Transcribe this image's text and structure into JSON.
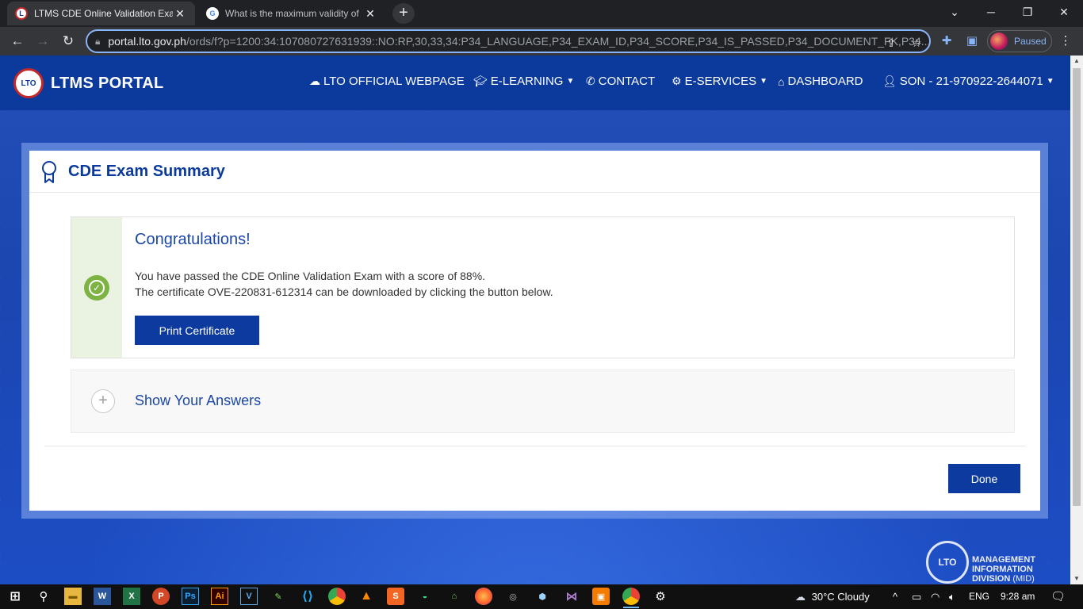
{
  "browser": {
    "tabs": [
      {
        "title": "LTMS CDE Online Validation Exam",
        "active": true
      },
      {
        "title": "What is the maximum validity of",
        "active": false
      }
    ],
    "url_host": "portal.lto.gov.ph",
    "url_path": "/ords/f?p=1200:34:107080727631939::NO:RP,30,33,34:P34_LANGUAGE,P34_EXAM_ID,P34_SCORE,P34_IS_PASSED,P34_DOCUMENT_FK,P34...",
    "profile_status": "Paused"
  },
  "nav": {
    "brand": "LTMS PORTAL",
    "logo_text": "LTO",
    "items": [
      {
        "label": "LTO OFFICIAL WEBPAGE",
        "icon": "cloud-icon"
      },
      {
        "label": "E-LEARNING",
        "icon": "graduation-cap-icon",
        "dropdown": true
      },
      {
        "label": "CONTACT",
        "icon": "phone-icon"
      },
      {
        "label": "E-SERVICES",
        "icon": "gear-icon",
        "dropdown": true
      },
      {
        "label": "DASHBOARD",
        "icon": "home-icon"
      },
      {
        "label": "SON - 21-970922-2644071",
        "icon": "user-icon",
        "dropdown": true
      }
    ]
  },
  "summary": {
    "title": "CDE Exam Summary",
    "congrats_title": "Congratulations!",
    "line1": "You have passed the CDE Online Validation Exam with a score of 88%.",
    "line2": "The certificate OVE-220831-612314 can be downloaded by clicking the button below.",
    "print_label": "Print Certificate",
    "answers_label": "Show Your Answers",
    "done_label": "Done"
  },
  "footer_logo": {
    "emblem": "LTO",
    "line1": "MANAGEMENT",
    "line2": "INFORMATION",
    "line3": "DIVISION",
    "line3_suffix": "(MID)"
  },
  "taskbar": {
    "weather": "30°C  Cloudy",
    "lang": "ENG",
    "time": "9:28 am"
  },
  "colors": {
    "brand_blue": "#0b3a9c",
    "success_green": "#7cb342"
  }
}
